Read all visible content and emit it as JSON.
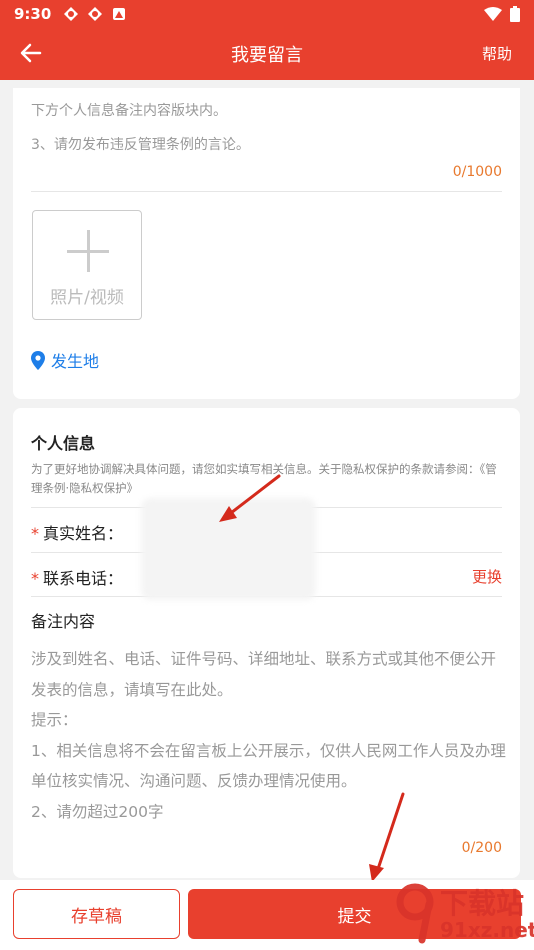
{
  "status": {
    "time": "9:30"
  },
  "header": {
    "title": "我要留言",
    "help": "帮助"
  },
  "card1": {
    "hint_line1": "下方个人信息备注内容版块内。",
    "hint_line2": "3、请勿发布违反管理条例的言论。",
    "counter": "0/1000",
    "upload_label": "照片/视频",
    "location_label": "发生地"
  },
  "personal": {
    "title": "个人信息",
    "desc": "为了更好地协调解决具体问题，请您如实填写相关信息。关于隐私权保护的条款请参阅：《管理条例·隐私权保护》",
    "name_label": "真实姓名：",
    "phone_label": "联系电话：",
    "change": "更换",
    "required_mark": "*"
  },
  "remark": {
    "title": "备注内容",
    "line1": "涉及到姓名、电话、证件号码、详细地址、联系方式或其他不便公开发表的信息，请填写在此处。",
    "line2": "提示：",
    "line3": "1、相关信息将不会在留言板上公开展示，仅供人民网工作人员及办理单位核实情况、沟通问题、反馈办理情况使用。",
    "line4": "2、请勿超过200字",
    "counter": "0/200"
  },
  "bottom": {
    "draft": "存草稿",
    "submit": "提交"
  },
  "watermark": {
    "main": "下载站",
    "sub": "91xz.net"
  },
  "colors": {
    "brand": "#e8402e",
    "link": "#1e7ee8",
    "counter": "#e8792e"
  }
}
